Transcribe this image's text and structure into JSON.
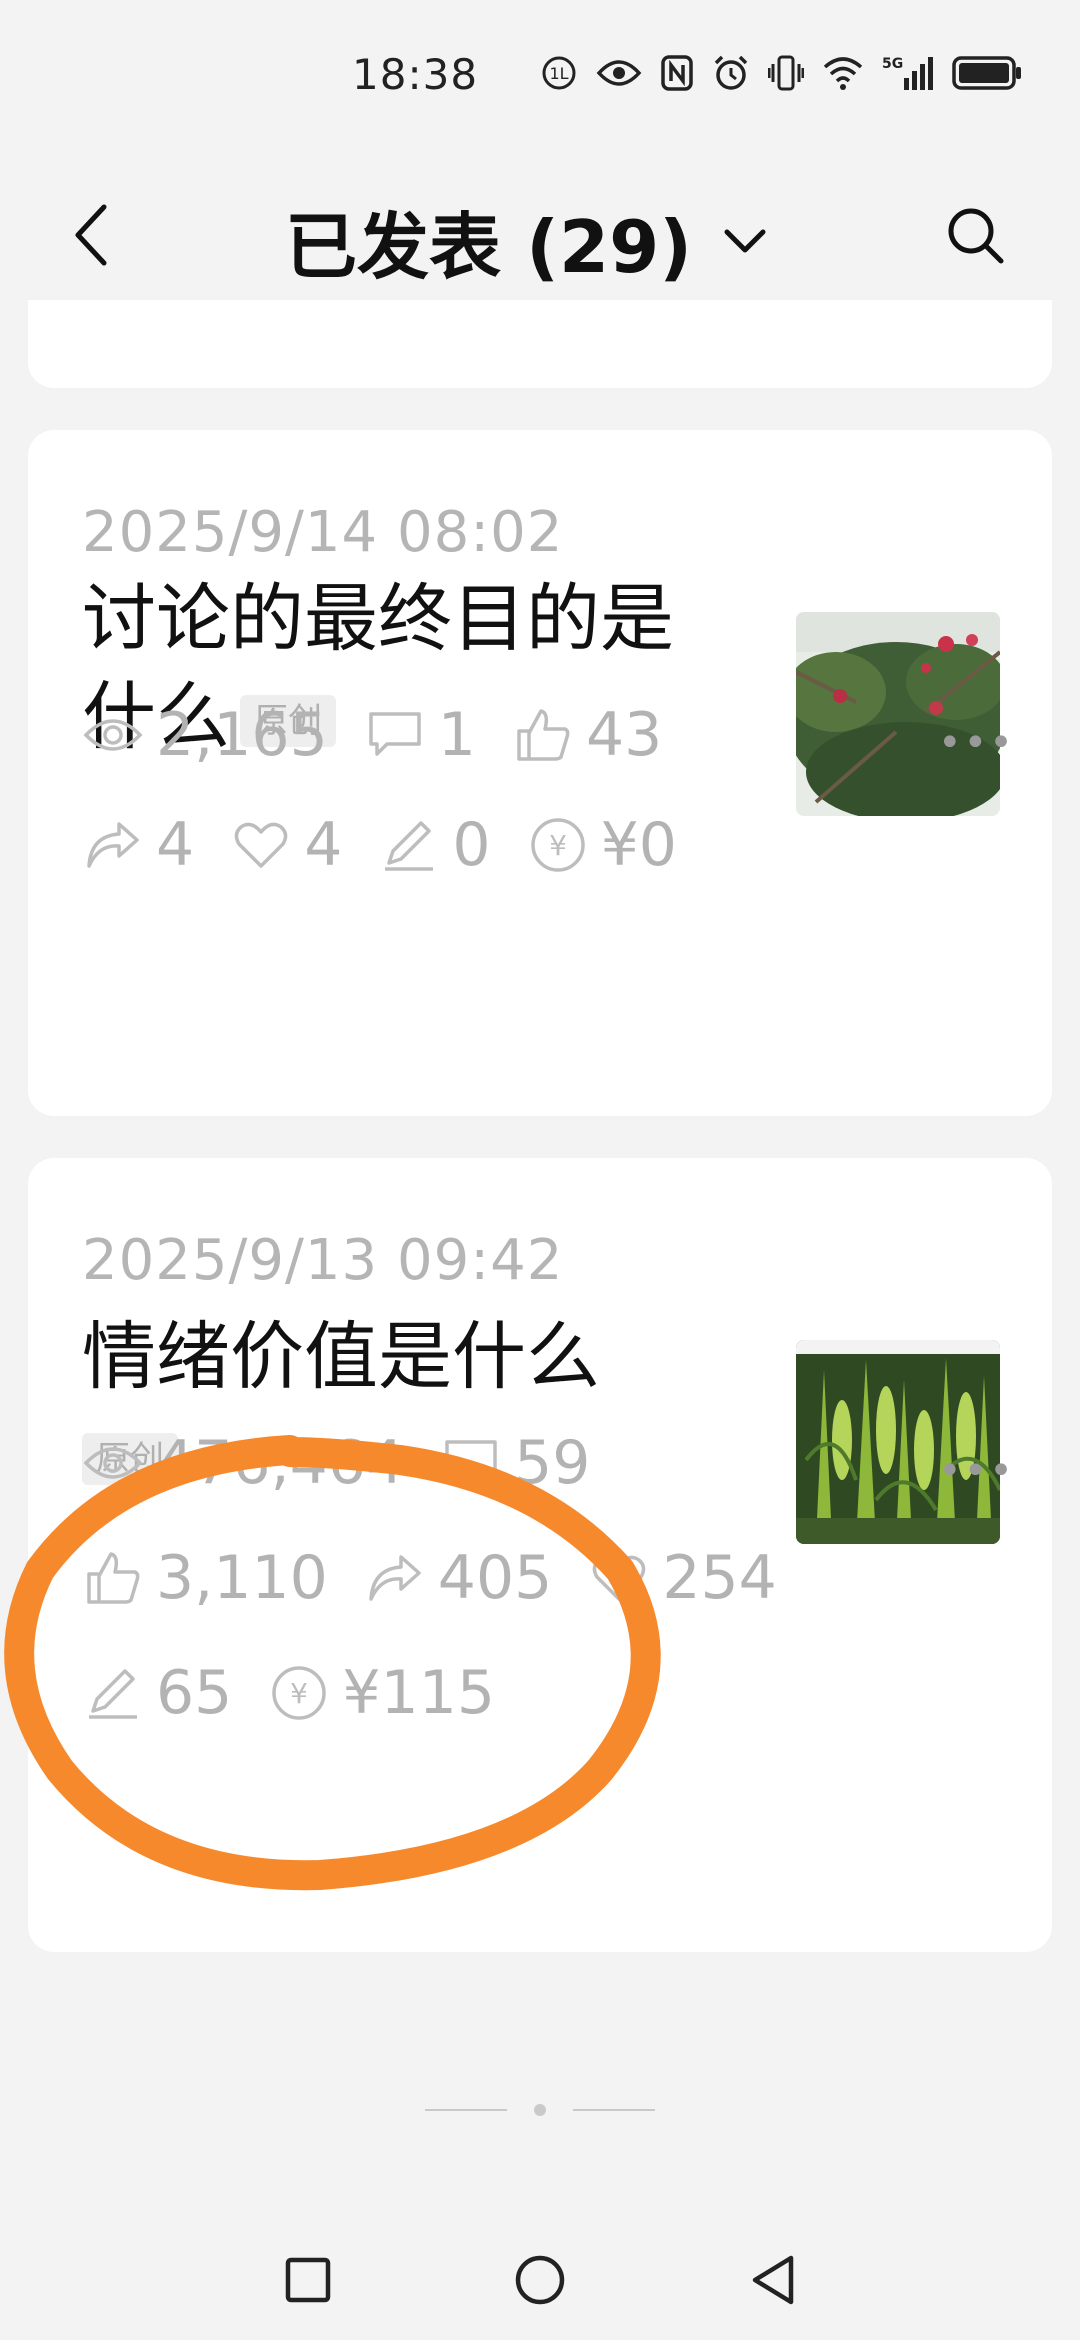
{
  "status_bar": {
    "time": "18:38",
    "network": "5G",
    "icons": [
      "hd-call-icon",
      "eye-comfort-icon",
      "nfc-icon",
      "alarm-icon",
      "vibrate-icon",
      "wifi-icon",
      "signal-icon",
      "battery-icon"
    ]
  },
  "header": {
    "title": "已发表 (29)",
    "back_icon": "chevron-left-icon",
    "dropdown_icon": "chevron-down-icon",
    "search_icon": "search-icon"
  },
  "posts": [
    {
      "date": "2025/9/14 08:02",
      "title": "讨论的最终目的是什么",
      "badge": "原创",
      "thumb": "tree-with-red-fruit",
      "stats": {
        "views": "2,165",
        "comments": "1",
        "likes": "43",
        "shares": "4",
        "favorites": "4",
        "edits": "0",
        "income": "¥0"
      }
    },
    {
      "date": "2025/9/13 09:42",
      "title": "情绪价值是什么",
      "badge": "原创",
      "thumb": "green-corn-field",
      "stats": {
        "views": "476,464",
        "comments": "59",
        "likes": "3,110",
        "shares": "405",
        "favorites": "254",
        "edits": "65",
        "income": "¥115"
      }
    }
  ],
  "colors": {
    "background": "#f2f3f2",
    "card": "#ffffff",
    "muted_text": "#b3b3b3",
    "annotation": "#f7892d"
  }
}
